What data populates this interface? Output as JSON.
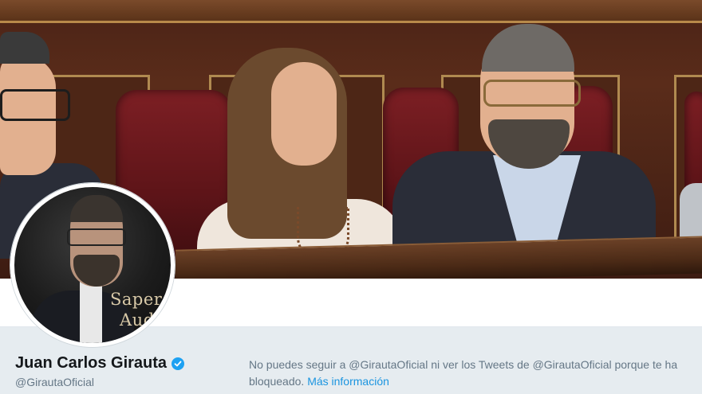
{
  "profile": {
    "name": "Juan Carlos Girauta",
    "handle": "@GirautaOficial",
    "verified": true
  },
  "avatar": {
    "caption_line1": "Sapere",
    "caption_line2": "Aud"
  },
  "notice": {
    "text": "No puedes seguir a @GirautaOficial ni ver los Tweets de @GirautaOficial porque te ha bloqueado.",
    "link_label": "Más información"
  },
  "colors": {
    "link": "#1b95e0",
    "verified_badge": "#1da1f2",
    "secondary_text": "#657786",
    "page_background": "#e6ecf0"
  },
  "icons": {
    "verified": "verified-badge-icon"
  }
}
